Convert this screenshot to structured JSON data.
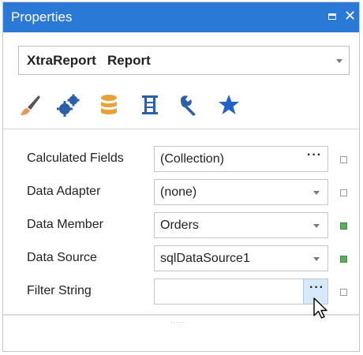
{
  "window": {
    "title": "Properties",
    "maximize_icon": "maximize-icon",
    "close_glyph": "✕"
  },
  "object_selector": {
    "value": "XtraReport   Report"
  },
  "tabs": [
    {
      "name": "appearance",
      "icon": "brush-icon"
    },
    {
      "name": "behavior",
      "icon": "gears-icon"
    },
    {
      "name": "data",
      "icon": "database-icon",
      "selected": true
    },
    {
      "name": "layout",
      "icon": "layout-icon"
    },
    {
      "name": "design",
      "icon": "wrench-icon"
    },
    {
      "name": "favorites",
      "icon": "star-icon"
    }
  ],
  "properties": [
    {
      "label": "Calculated Fields",
      "value": "(Collection)",
      "editor": "ellipsis",
      "button_text": "···",
      "modified": false
    },
    {
      "label": "Data Adapter",
      "value": "(none)",
      "editor": "dropdown",
      "modified": false
    },
    {
      "label": "Data Member",
      "value": "Orders",
      "editor": "dropdown",
      "modified": true
    },
    {
      "label": "Data Source",
      "value": "sqlDataSource1",
      "editor": "dropdown",
      "modified": true
    },
    {
      "label": "Filter String",
      "value": "",
      "editor": "ellipsis-hover",
      "button_text": "···",
      "modified": false
    }
  ],
  "colors": {
    "titlebar": "#2b79d7",
    "modified_marker": "#5cae5c",
    "data_icon": "#e7a23a",
    "star": "#1f63c6"
  },
  "splitter": {
    "grip": "·····"
  }
}
